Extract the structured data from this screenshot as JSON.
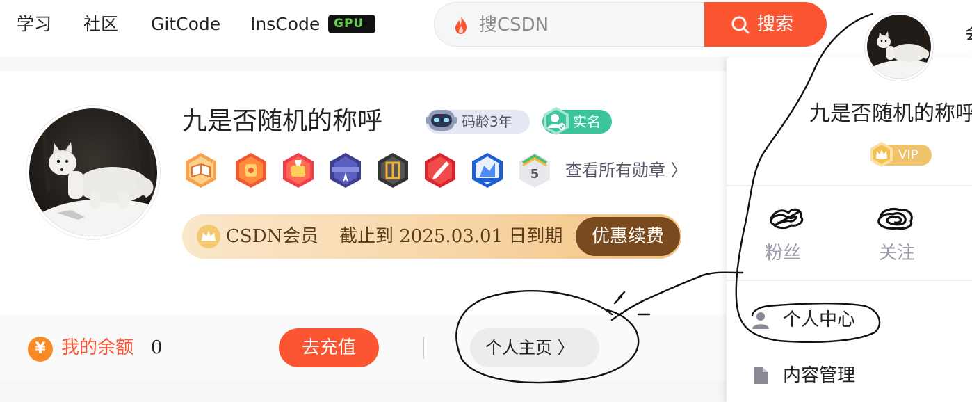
{
  "nav": {
    "items": [
      "学习",
      "社区",
      "GitCode",
      "InsCode"
    ],
    "gpu_badge": "GPU",
    "search_placeholder": "搜CSDN",
    "search_button": "搜索"
  },
  "profile": {
    "username": "九是否随机的称呼",
    "code_age": "码龄3年",
    "realname": "实名",
    "medals": [
      "medal-1",
      "medal-2",
      "medal-3",
      "medal-4",
      "medal-5",
      "medal-6",
      "medal-7",
      "medal-8"
    ],
    "all_medals_link": "查看所有勋章 〉",
    "vip": {
      "label": "CSDN会员",
      "expire": "截止到 2025.03.01 日到期",
      "renew_button": "优惠续费"
    }
  },
  "bottom": {
    "balance_label": "我的余额",
    "balance_value": "0",
    "yen_symbol": "¥",
    "recharge_button": "去充值",
    "homepage_button": "个人主页 〉"
  },
  "panel": {
    "name": "九是否随机的称呼",
    "vip_badge": "VIP",
    "stats": [
      {
        "label": "粉丝"
      },
      {
        "label": "关注"
      }
    ],
    "menu": [
      {
        "label": "个人中心",
        "icon": "person-icon"
      },
      {
        "label": "内容管理",
        "icon": "doc-icon"
      }
    ],
    "clipped_char": "会"
  },
  "colors": {
    "accent": "#fc5531",
    "vip_brown": "#7a4a1f",
    "realname_green": "#3cc59c"
  }
}
